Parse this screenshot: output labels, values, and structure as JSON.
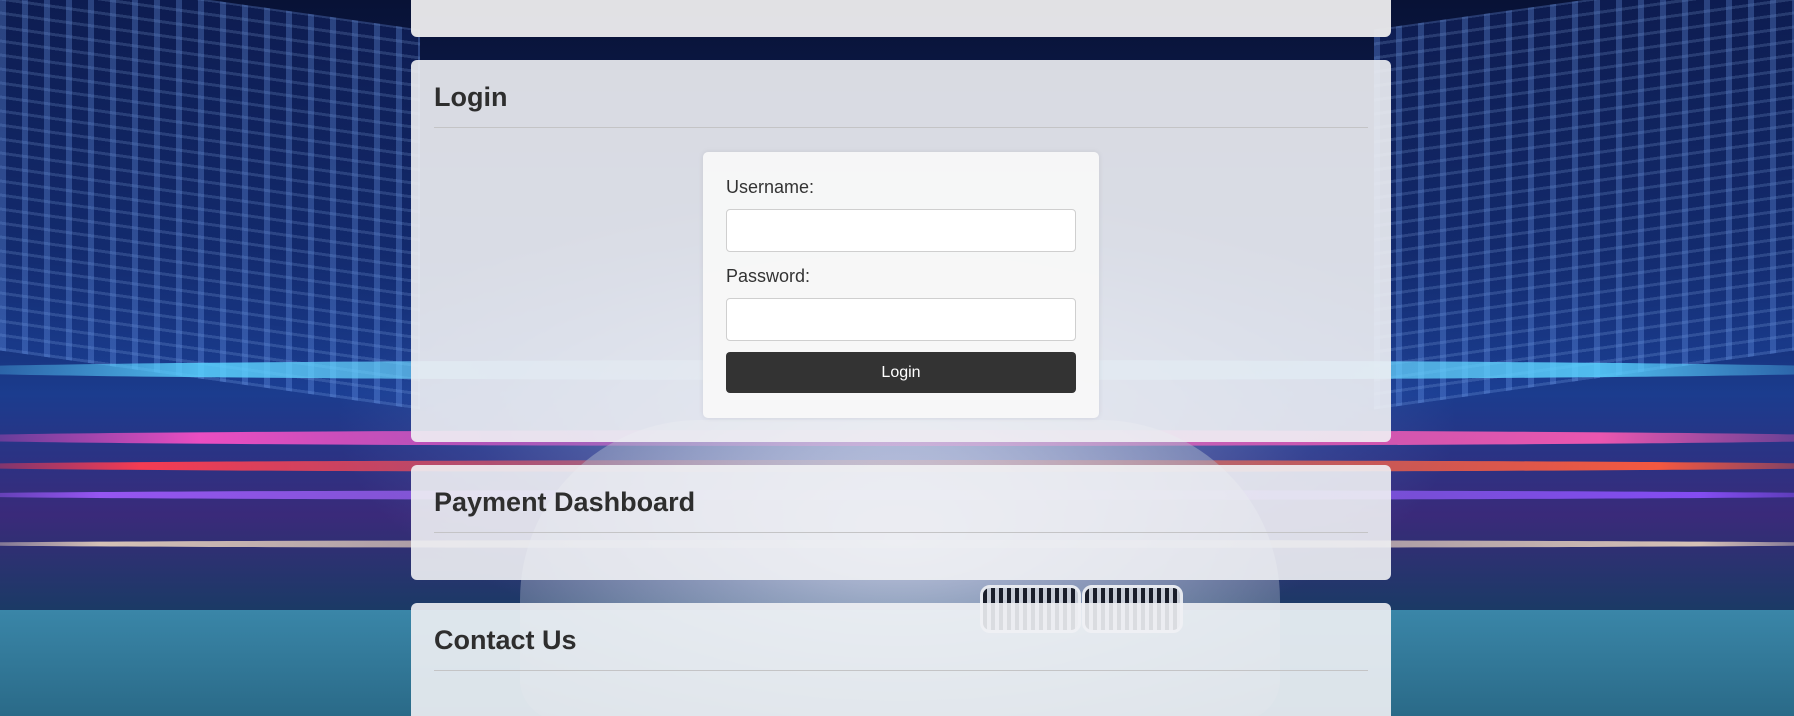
{
  "login": {
    "title": "Login",
    "username_label": "Username:",
    "username_value": "",
    "password_label": "Password:",
    "password_value": "",
    "button_label": "Login"
  },
  "payment": {
    "title": "Payment Dashboard"
  },
  "contact": {
    "title": "Contact Us"
  },
  "colors": {
    "panel_bg": "#f0f1f4",
    "button_bg": "#333333",
    "button_text": "#ffffff",
    "title_text": "#2e2e2e"
  }
}
